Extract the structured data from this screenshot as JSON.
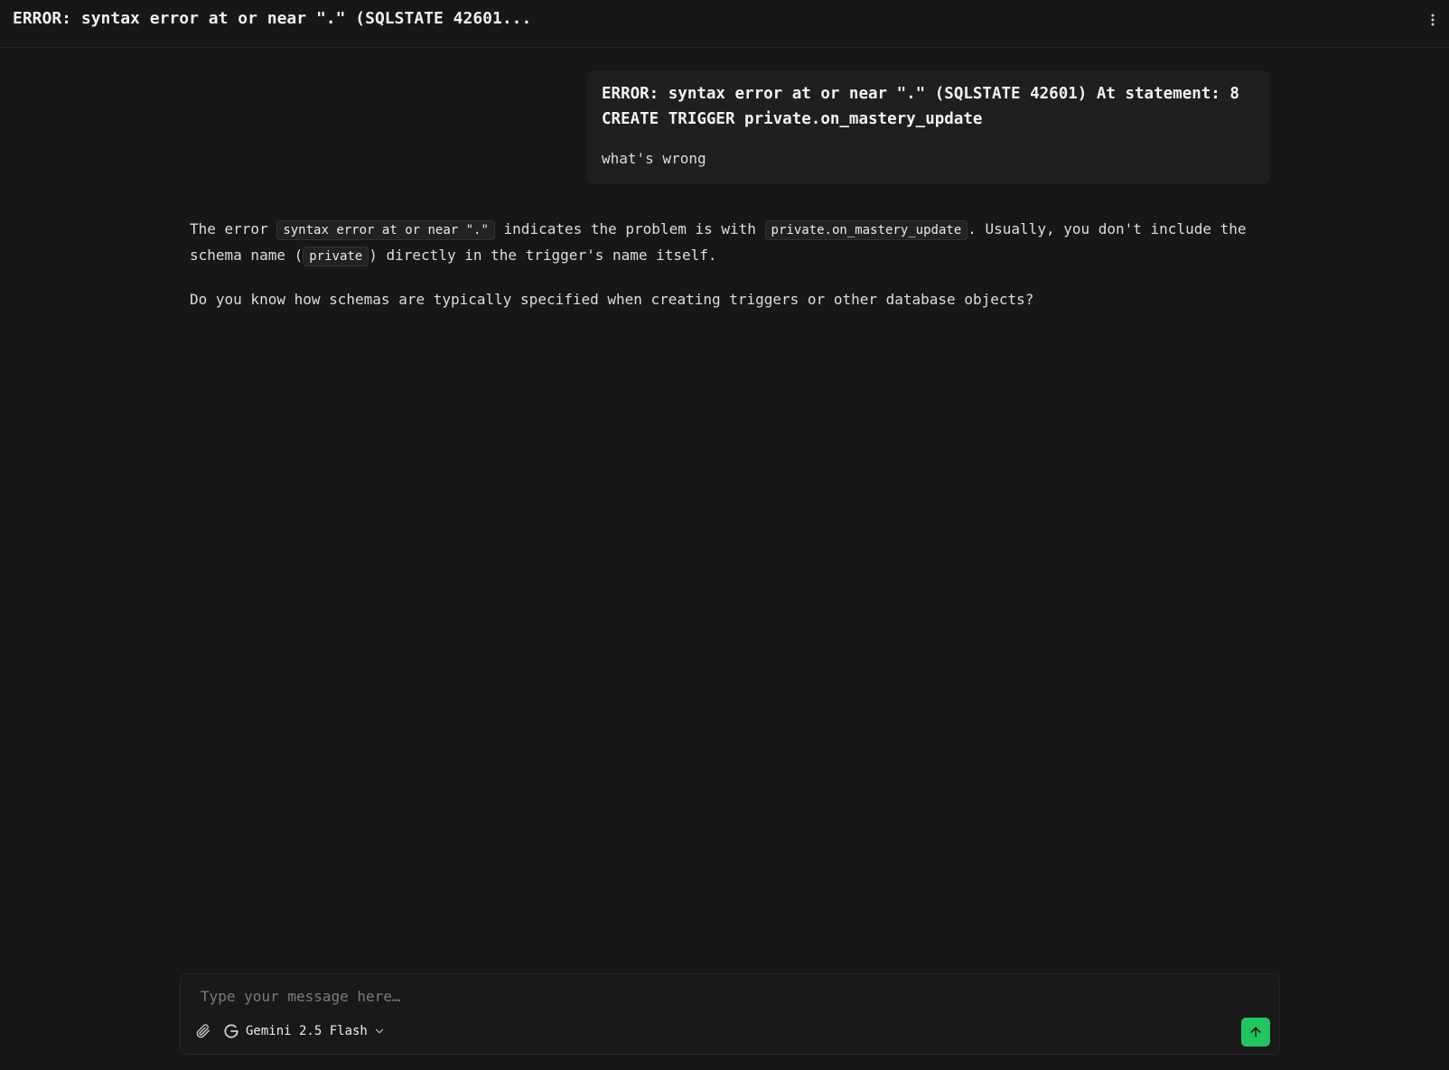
{
  "header": {
    "title": "ERROR: syntax error at or near \".\" (SQLSTATE 42601...",
    "menu_icon": "kebab-icon"
  },
  "user_message": {
    "line1": "ERROR: syntax error at or near \".\" (SQLSTATE 42601) At statement: 8",
    "line2": "CREATE TRIGGER private.on_mastery_update",
    "text": "what's wrong"
  },
  "assistant_message": {
    "p1_a": "The error ",
    "p1_code1": "syntax error at or near \".\"",
    "p1_b": " indicates the problem is with ",
    "p1_code2": "private.on_mastery_update",
    "p1_c": ". Usually, you don't include the schema name (",
    "p1_code3": "private",
    "p1_d": ") directly in the trigger's name itself.",
    "p2": "Do you know how schemas are typically specified when creating triggers or other database objects?"
  },
  "composer": {
    "placeholder": "Type your message here…",
    "model_label": "Gemini 2.5 Flash",
    "attach_icon": "paperclip-icon",
    "model_icon": "google-g-icon",
    "dropdown_icon": "chevron-down-icon",
    "send_icon": "arrow-up-icon"
  },
  "colors": {
    "background": "#171717",
    "accent": "#22c55e"
  }
}
